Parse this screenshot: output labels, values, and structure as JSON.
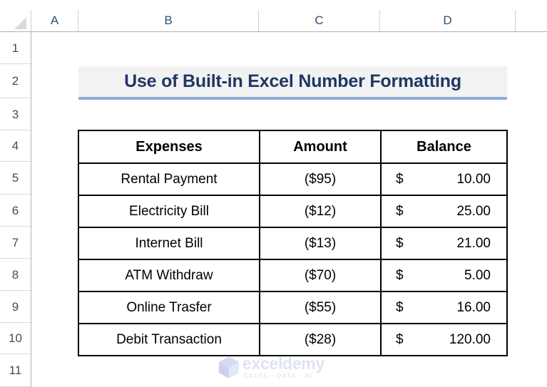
{
  "app": "excel-worksheet",
  "grid": {
    "column_headers": [
      "A",
      "B",
      "C",
      "D"
    ],
    "row_headers": [
      "1",
      "2",
      "3",
      "4",
      "5",
      "6",
      "7",
      "8",
      "9",
      "10",
      "11"
    ],
    "select_all_icon": "select-all-triangle"
  },
  "title": {
    "text": "Use of Built-in Excel Number Formatting",
    "text_color": "#1f3864",
    "fill_color": "#f2f2f2",
    "underline_color": "#8faadc"
  },
  "table": {
    "headers": [
      {
        "label": "Expenses",
        "fill": "#bdd7ee"
      },
      {
        "label": "Amount",
        "fill": "#fce4d6"
      },
      {
        "label": "Balance",
        "fill": "#e2efda"
      }
    ],
    "negative_color": "#ff0000",
    "currency_symbol": "$",
    "rows": [
      {
        "expense": "Rental Payment",
        "amount": "($95)",
        "balance_symbol": "$",
        "balance_value": "10.00"
      },
      {
        "expense": "Electricity Bill",
        "amount": "($12)",
        "balance_symbol": "$",
        "balance_value": "25.00"
      },
      {
        "expense": "Internet Bill",
        "amount": "($13)",
        "balance_symbol": "$",
        "balance_value": "21.00"
      },
      {
        "expense": "ATM Withdraw",
        "amount": "($70)",
        "balance_symbol": "$",
        "balance_value": "5.00"
      },
      {
        "expense": "Online Trasfer",
        "amount": "($55)",
        "balance_symbol": "$",
        "balance_value": "16.00"
      },
      {
        "expense": "Debit Transaction",
        "amount": "($28)",
        "balance_symbol": "$",
        "balance_value": "120.00"
      }
    ]
  },
  "watermark": {
    "name": "exceldemy",
    "tagline": "EXCEL - DATA - BI",
    "logo_icon": "cube-logo-icon",
    "color": "#dde3f5"
  }
}
